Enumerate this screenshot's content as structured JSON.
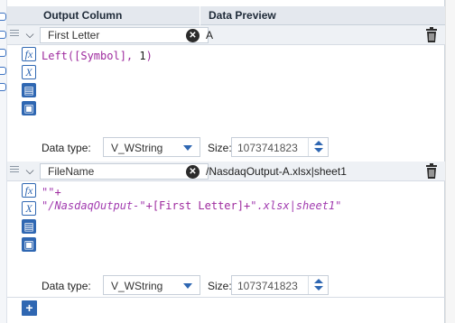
{
  "header": {
    "col_output": "Output Column",
    "col_preview": "Data Preview"
  },
  "fields": [
    {
      "name": "First Letter",
      "preview": "A",
      "expression_lines": [
        [
          {
            "t": "Left(",
            "c": "pur"
          },
          {
            "t": "[Symbol]",
            "c": "pur"
          },
          {
            "t": ", ",
            "c": "pur"
          },
          {
            "t": "1",
            "c": "blk"
          },
          {
            "t": ")",
            "c": "pur"
          }
        ]
      ],
      "data_type_label": "Data type:",
      "data_type": "V_WString",
      "size_label": "Size:",
      "size": "1073741823"
    },
    {
      "name": "FileName",
      "preview": "/NasdaqOutput-A.xlsx|sheet1",
      "expression_lines": [
        [
          {
            "t": "\"\"",
            "c": "str"
          },
          {
            "t": "+",
            "c": "pur"
          }
        ],
        [
          {
            "t": "\"/NasdaqOutput-\"",
            "c": "str"
          },
          {
            "t": "+",
            "c": "pur"
          },
          {
            "t": "[First Letter]",
            "c": "pur"
          },
          {
            "t": "+",
            "c": "pur"
          },
          {
            "t": "\".xlsx|sheet1\"",
            "c": "str"
          }
        ]
      ],
      "data_type_label": "Data type:",
      "data_type": "V_WString",
      "size_label": "Size:",
      "size": "1073741823"
    }
  ],
  "icons": [
    "chevron-down-icon",
    "clear-icon",
    "trash-icon",
    "function-icon",
    "variable-icon",
    "open-folder-icon",
    "save-icon",
    "add-icon"
  ],
  "colors": {
    "accent": "#2f67b2",
    "header_bg": "#e4e8ee",
    "field_var": "#9e2a9e",
    "string": "#a23cb0"
  },
  "add_label": "+"
}
